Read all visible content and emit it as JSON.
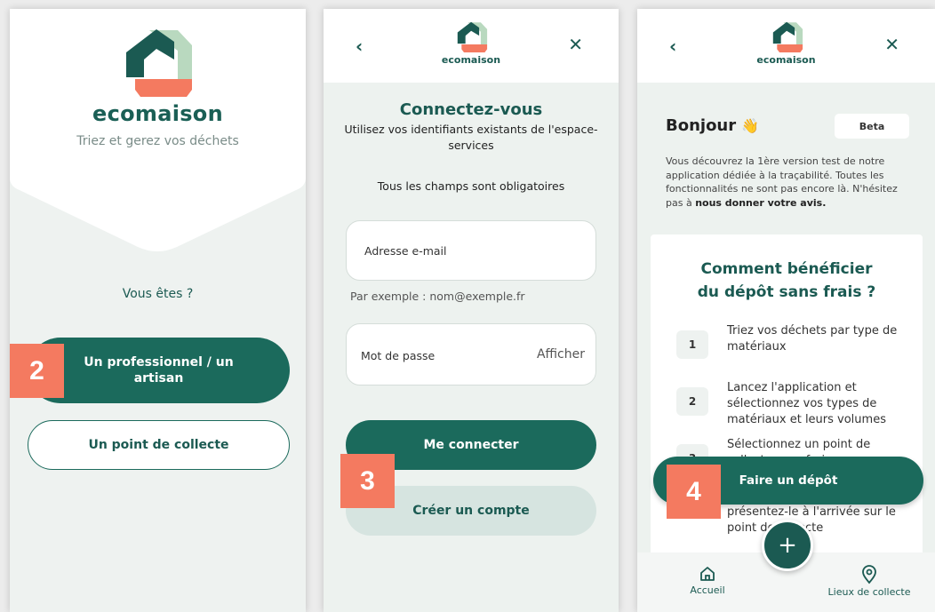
{
  "brand": {
    "name": "ecomaison",
    "colors": {
      "primary": "#1b6a5c",
      "accent": "#f47a60",
      "light": "#b9d9bf"
    }
  },
  "screen1": {
    "tagline": "Triez et gerez vos déchets",
    "question": "Vous êtes ?",
    "btn_pro": "Un professionnel / un artisan",
    "btn_collecte": "Un point de collecte"
  },
  "screen2": {
    "header": {
      "back_icon": "‹",
      "close_icon": "✕",
      "brand": "ecomaison"
    },
    "title": "Connectez-vous",
    "subtitle": "Utilisez vos identifiants existants de l'espace-services",
    "required_note": "Tous les champs sont obligatoires",
    "email_label": "Adresse e-mail",
    "email_hint": "Par exemple : nom@exemple.fr",
    "password_label": "Mot de passe",
    "show_password": "Afficher",
    "btn_login": "Me connecter",
    "btn_create": "Créer un compte"
  },
  "screen3": {
    "header": {
      "back_icon": "‹",
      "close_icon": "✕",
      "brand": "ecomaison"
    },
    "greeting": "Bonjour",
    "wave_icon": "👋",
    "beta": "Beta",
    "intro_text": "Vous découvrez la 1ère version test de notre application dédiée à la traçabilité. Toutes les fonctionnalités ne sont pas encore là. N'hésitez pas à ",
    "intro_link": "nous donner votre avis.",
    "card_title_line1": "Comment bénéficier",
    "card_title_line2": "du dépôt sans frais ?",
    "steps": [
      {
        "num": "1",
        "text": "Triez vos déchets par type de matériaux"
      },
      {
        "num": "2",
        "text": "Lancez l'application et sélectionnez vos types de matériaux et leurs volumes"
      },
      {
        "num": "3",
        "text": "Sélectionnez un point de collecte sans frais"
      }
    ],
    "step4_partial": "présentez-le à l'arrivée sur le point de collecte",
    "btn_depot": "Faire un dépôt",
    "fab": "+",
    "nav": {
      "home": "Accueil",
      "places": "Lieux de collecte"
    }
  },
  "badges": [
    "2",
    "3",
    "4"
  ]
}
